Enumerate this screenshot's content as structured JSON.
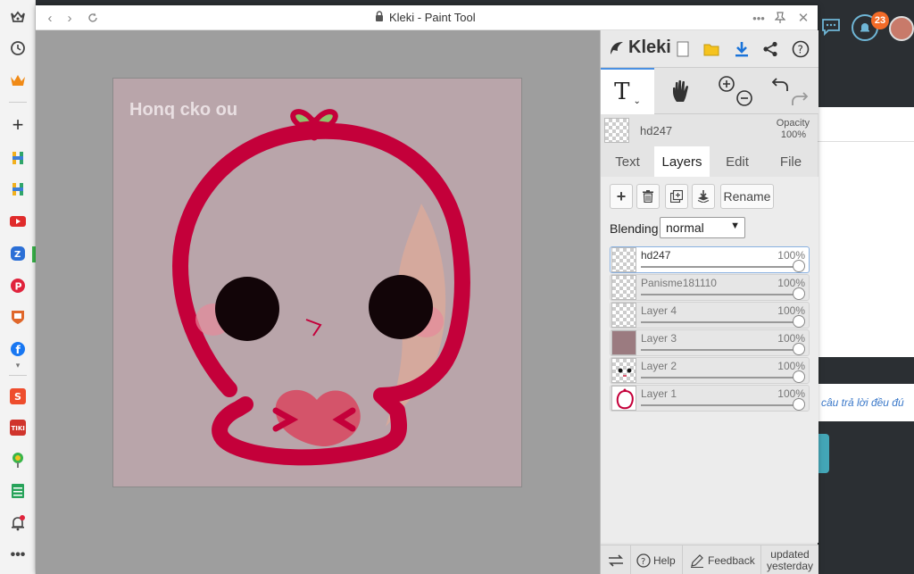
{
  "window": {
    "title": "Kleki - Paint Tool"
  },
  "canvas": {
    "text": "Honq cko ou"
  },
  "panel": {
    "logo": "Kleki",
    "current_layer": {
      "name": "hd247",
      "opacity_label": "Opacity",
      "opacity_value": "100%"
    },
    "tabs": [
      {
        "label": "Text"
      },
      {
        "label": "Layers"
      },
      {
        "label": "Edit"
      },
      {
        "label": "File"
      }
    ],
    "layer_actions": {
      "rename": "Rename"
    },
    "blending": {
      "label": "Blending",
      "value": "normal"
    },
    "layers": [
      {
        "name": "hd247",
        "opacity": "100%"
      },
      {
        "name": "Panisme181110",
        "opacity": "100%"
      },
      {
        "name": "Layer 4",
        "opacity": "100%"
      },
      {
        "name": "Layer 3",
        "opacity": "100%"
      },
      {
        "name": "Layer 2",
        "opacity": "100%"
      },
      {
        "name": "Layer 1",
        "opacity": "100%"
      }
    ],
    "footer": {
      "help": "Help",
      "feedback": "Feedback",
      "updated_line1": "updated",
      "updated_line2": "yesterday"
    }
  },
  "background": {
    "notification_count": "23",
    "snippet_text": "câu trả lời đều đú"
  },
  "colors": {
    "accent": "#4a90e2",
    "character_red": "#c4003a",
    "canvas_bg": "#b9a5aa"
  }
}
